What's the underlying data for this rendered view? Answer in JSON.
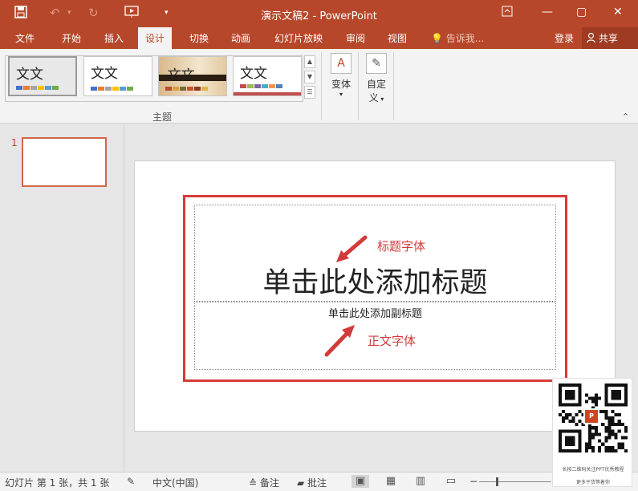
{
  "window": {
    "title": "演示文稿2 - PowerPoint",
    "quick_access": {
      "save_icon": "save-icon",
      "undo_icon": "undo-icon",
      "redo_icon": "redo-icon",
      "present_icon": "start-from-beginning-icon",
      "customize_icon": "chevron-down-icon"
    },
    "controls": {
      "ribbon_display": "ribbon-display-options-icon",
      "minimize": "—",
      "restore": "▢",
      "close": "✕"
    }
  },
  "tabs": [
    {
      "label": "文件"
    },
    {
      "label": "开始"
    },
    {
      "label": "插入"
    },
    {
      "label": "设计"
    },
    {
      "label": "切换"
    },
    {
      "label": "动画"
    },
    {
      "label": "幻灯片放映"
    },
    {
      "label": "审阅"
    },
    {
      "label": "视图"
    }
  ],
  "tell_me": {
    "icon": "lightbulb-icon",
    "text": "告诉我..."
  },
  "signin": "登录",
  "share": {
    "label": "共享",
    "icon": "user-icon"
  },
  "ribbon": {
    "theme_group_label": "主题",
    "themes": [
      {
        "word": "文文",
        "swatches": [
          "#4472c4",
          "#ed7d31",
          "#a5a5a5",
          "#ffc000",
          "#5b9bd5",
          "#70ad47"
        ]
      },
      {
        "word": "文文",
        "swatches": [
          "#4472c4",
          "#ed7d31",
          "#a5a5a5",
          "#ffc000",
          "#5b9bd5",
          "#70ad47"
        ]
      },
      {
        "word": "文文",
        "swatches": [
          "#b84c2b",
          "#d9a23b",
          "#7a6a3b",
          "#c7542f",
          "#8c3c24",
          "#e0b24a"
        ]
      },
      {
        "word": "文文",
        "swatches": [
          "#c0504d",
          "#9bbb59",
          "#8064a2",
          "#4bacc6",
          "#f79646",
          "#4f81bd"
        ]
      }
    ],
    "variants_label": "变体",
    "customize_label_1": "自定",
    "customize_label_2": "义"
  },
  "slides": [
    {
      "number": "1"
    }
  ],
  "slide": {
    "title_placeholder": "单击此处添加标题",
    "subtitle_placeholder": "单击此处添加副标题",
    "annotation_title_font": "标题字体",
    "annotation_body_font": "正文字体",
    "accent_color": "#d63b3b"
  },
  "status": {
    "slide_info": "幻灯片 第 1 张，共 1 张",
    "language": "中文(中国)",
    "notes": "备注",
    "comments": "批注"
  },
  "qr_card": {
    "text_1": "长按二维码关注PPT优秀教程",
    "text_2": "更多干货等着你"
  }
}
